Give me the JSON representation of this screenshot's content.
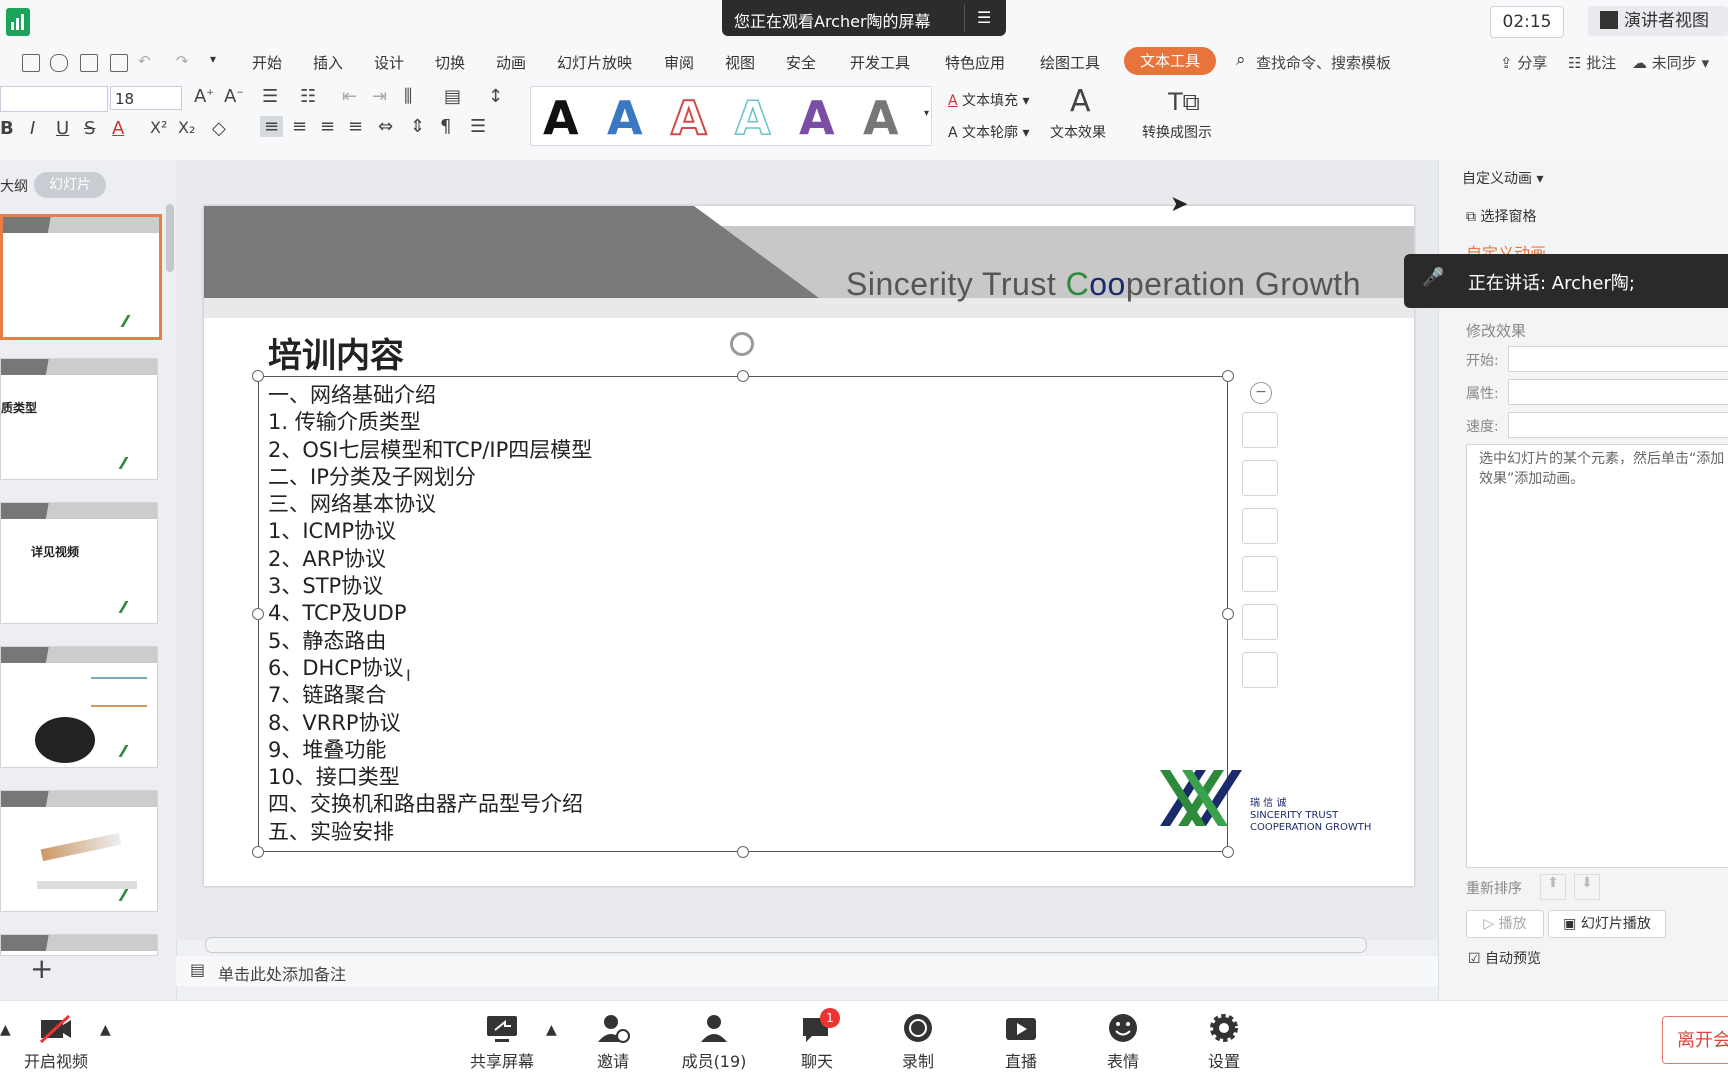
{
  "topbar": {
    "banner_text": "您正在观看Archer陶的屏幕",
    "timer": "02:15",
    "presenter_view": "演讲者视图"
  },
  "menu": [
    "开始",
    "插入",
    "设计",
    "切换",
    "动画",
    "幻灯片放映",
    "审阅",
    "视图",
    "安全",
    "开发工具",
    "特色应用",
    "绘图工具"
  ],
  "menu_active": "文本工具",
  "search_placeholder": "查找命令、搜索模板",
  "menu_right": {
    "share": "分享",
    "comment": "批注",
    "sync": "未同步"
  },
  "ribbon": {
    "font_size": "18",
    "bold": "B",
    "italic": "I",
    "underline": "U",
    "strike": "S",
    "text_fill": "文本填充",
    "text_outline": "文本轮廓",
    "text_effect": "文本效果",
    "convert_smartart": "转换成图示",
    "gallery_letter": "A"
  },
  "left_panel": {
    "tab_outline": "大纲",
    "tab_slides": "幻灯片",
    "thumb_captions": [
      "",
      "质类型",
      "详见视频",
      "",
      "",
      ""
    ],
    "add_label": "+"
  },
  "slide": {
    "slogan_parts": [
      "Sincerity Trust ",
      "C",
      "oo",
      "peration",
      "  Growth"
    ],
    "title": "培训内容",
    "outline": [
      "一、网络基础介绍",
      "1.   传输介质类型",
      "2、OSI七层模型和TCP/IP四层模型",
      "二、IP分类及子网划分",
      "三、网络基本协议",
      "1、ICMP协议",
      "2、ARP协议",
      "3、STP协议",
      "4、TCP及UDP",
      "5、静态路由",
      "6、DHCP协议",
      "7、链路聚合",
      "8、VRRP协议",
      "9、堆叠功能",
      "10、接口类型",
      "四、交换机和路由器产品型号介绍",
      "五、实验安排"
    ],
    "company_cn": "瑞 信 诚",
    "company_en_1": "SINCERITY TRUST",
    "company_en_2": "COOPERATION  GROWTH"
  },
  "notes_placeholder": "单击此处添加备注",
  "right_panel": {
    "custom_anim": "自定义动画",
    "select_pane": "选择窗格",
    "custom_anim_heading": "自定义动画",
    "speaking": "正在讲话: Archer陶;",
    "modify_effect": "修改效果",
    "start": "开始:",
    "property": "属性:",
    "speed": "速度:",
    "hint": "选中幻灯片的某个元素，然后单击“添加效果”添加动画。",
    "reorder": "重新排序",
    "play": "播放",
    "slideshow": "幻灯片播放",
    "auto_preview": "自动预览"
  },
  "meeting": {
    "video": "开启视频",
    "share": "共享屏幕",
    "invite": "邀请",
    "members": "成员(19)",
    "chat": "聊天",
    "chat_badge": "1",
    "record": "录制",
    "live": "直播",
    "emoji": "表情",
    "settings": "设置",
    "leave": "离开会"
  },
  "colors": {
    "accent": "#e9743b",
    "green": "#2d8a3a",
    "navy": "#1a2a6a"
  }
}
